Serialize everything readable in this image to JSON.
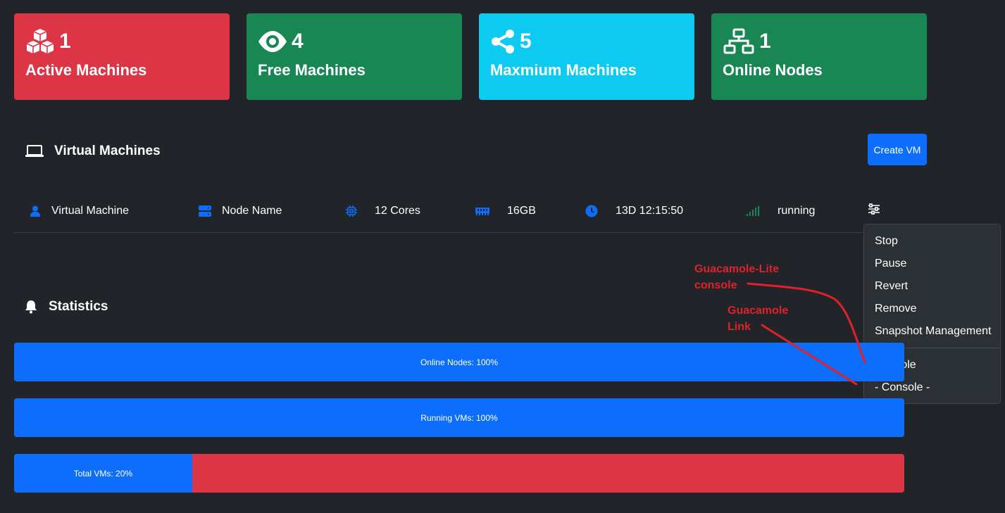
{
  "cards": [
    {
      "count": "1",
      "label": "Active Machines",
      "color": "#dc3545",
      "icon": "cubes-icon"
    },
    {
      "count": "4",
      "label": "Free Machines",
      "color": "#198754",
      "icon": "eye-icon"
    },
    {
      "count": "5",
      "label": "Maxmium Machines",
      "color": "#0dcaf0",
      "icon": "share-nodes-icon"
    },
    {
      "count": "1",
      "label": "Online Nodes",
      "color": "#198754",
      "icon": "network-icon"
    }
  ],
  "vm_section": {
    "title": "Virtual Machines",
    "icon": "laptop-icon",
    "create_label": "Create VM"
  },
  "vm_row": {
    "name": "Virtual Machine",
    "node": "Node Name",
    "cores": "12 Cores",
    "memory": "16GB",
    "uptime": "13D 12:15:50",
    "status": "running",
    "status_color": "#198754"
  },
  "dropdown": {
    "items": [
      "Stop",
      "Pause",
      "Revert",
      "Remove",
      "Snapshot Management"
    ],
    "console_items": [
      "Console",
      "- Console -"
    ]
  },
  "stats_section": {
    "title": "Statistics",
    "icon": "bell-icon"
  },
  "stats": [
    {
      "label": "Online Nodes: 100%",
      "percent": 100
    },
    {
      "label": "Running VMs: 100%",
      "percent": 100
    },
    {
      "label": "Total VMs: 20%",
      "percent": 20
    }
  ],
  "annotations": {
    "lite_line1": "Guacamole-Lite",
    "lite_line2": "console",
    "link_line1": "Guacamole",
    "link_line2": "Link",
    "color": "#e0212b"
  }
}
